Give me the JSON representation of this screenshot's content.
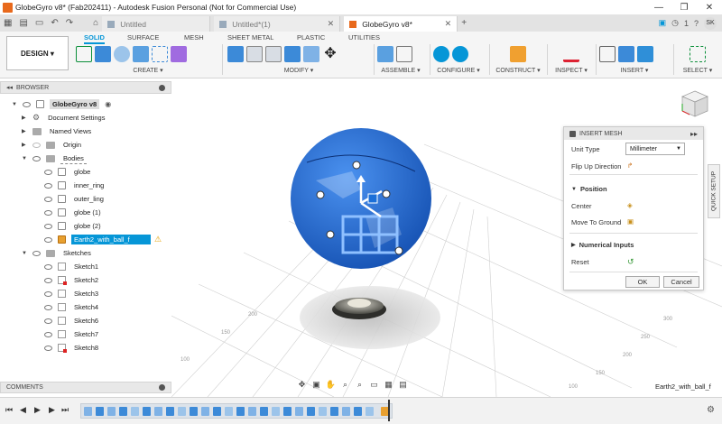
{
  "window": {
    "title": "GlobeGyro v8* (Fab202411) - Autodesk Fusion Personal (Not for Commercial Use)",
    "controls": [
      "—",
      "❐",
      "✕"
    ]
  },
  "tabs": [
    {
      "label": "Untitled",
      "active": false
    },
    {
      "label": "Untitled*(1)",
      "active": false
    },
    {
      "label": "GlobeGyro v8*",
      "active": true
    }
  ],
  "tabbar_right": {
    "count": "1",
    "user": "SK"
  },
  "toolbar": {
    "workspace": "DESIGN ▾",
    "tabs": [
      "SOLID",
      "SURFACE",
      "MESH",
      "SHEET METAL",
      "PLASTIC",
      "UTILITIES"
    ],
    "groups": [
      "CREATE ▾",
      "MODIFY ▾",
      "ASSEMBLE ▾",
      "CONFIGURE ▾",
      "CONSTRUCT ▾",
      "INSPECT ▾",
      "INSERT ▾",
      "SELECT ▾"
    ]
  },
  "browser": {
    "title": "BROWSER",
    "root": "GlobeGyro v8",
    "items": [
      "Document Settings",
      "Named Views",
      "Origin",
      "Bodies",
      "globe",
      "inner_ring",
      "outer_ling",
      "globe (1)",
      "globe (2)",
      "Earth2_with_ball_f",
      "Sketches",
      "Sketch1",
      "Sketch2",
      "Sketch3",
      "Sketch4",
      "Sketch6",
      "Sketch7",
      "Sketch8"
    ]
  },
  "comments": {
    "label": "COMMENTS"
  },
  "insert_mesh": {
    "title": "INSERT MESH",
    "unit_type_label": "Unit Type",
    "unit_type_value": "Millimeter",
    "flip_label": "Flip Up Direction",
    "position_label": "Position",
    "center_label": "Center",
    "move_ground_label": "Move To Ground",
    "numerical_label": "Numerical Inputs",
    "reset_label": "Reset",
    "ok_label": "OK",
    "cancel_label": "Cancel"
  },
  "side_tab": "QUICK SETUP",
  "status": {
    "selected": "Earth2_with_ball_f"
  },
  "colors": {
    "accent": "#0696d7",
    "mesh": "#1f6fd6",
    "brand": "#e8691c"
  }
}
